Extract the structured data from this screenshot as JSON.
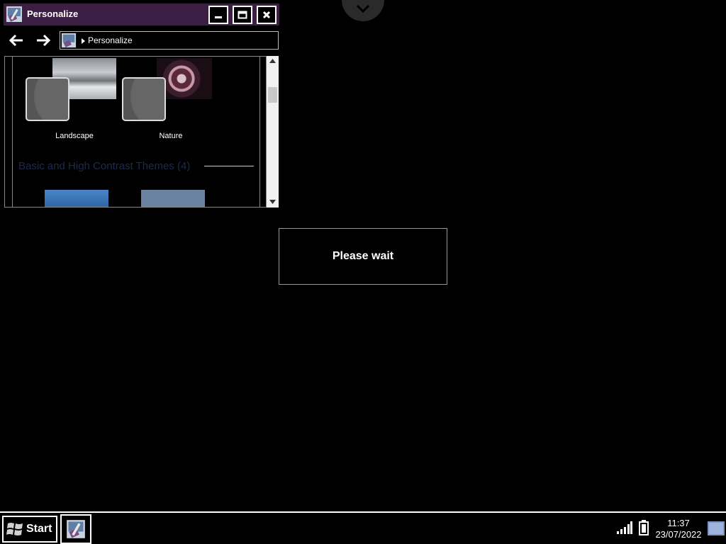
{
  "window": {
    "title": "Personalize",
    "app_icon": "personalize-icon",
    "controls": [
      "minimize-icon",
      "maximize-icon",
      "close-icon"
    ]
  },
  "navbar": {
    "back_icon": "arrow-left-icon",
    "forward_icon": "arrow-right-icon",
    "address": "Personalize"
  },
  "content": {
    "themes": [
      {
        "label": "Landscape"
      },
      {
        "label": "Nature"
      }
    ],
    "section_title": "Basic and High Contrast Themes (4)"
  },
  "dialog": {
    "message": "Please wait"
  },
  "taskbar": {
    "start_label": "Start",
    "time": "11:37",
    "date": "23/07/2022"
  },
  "colors": {
    "titlebar": "#3d1f45",
    "background": "#000000",
    "section_title": "#1f2a4a"
  }
}
